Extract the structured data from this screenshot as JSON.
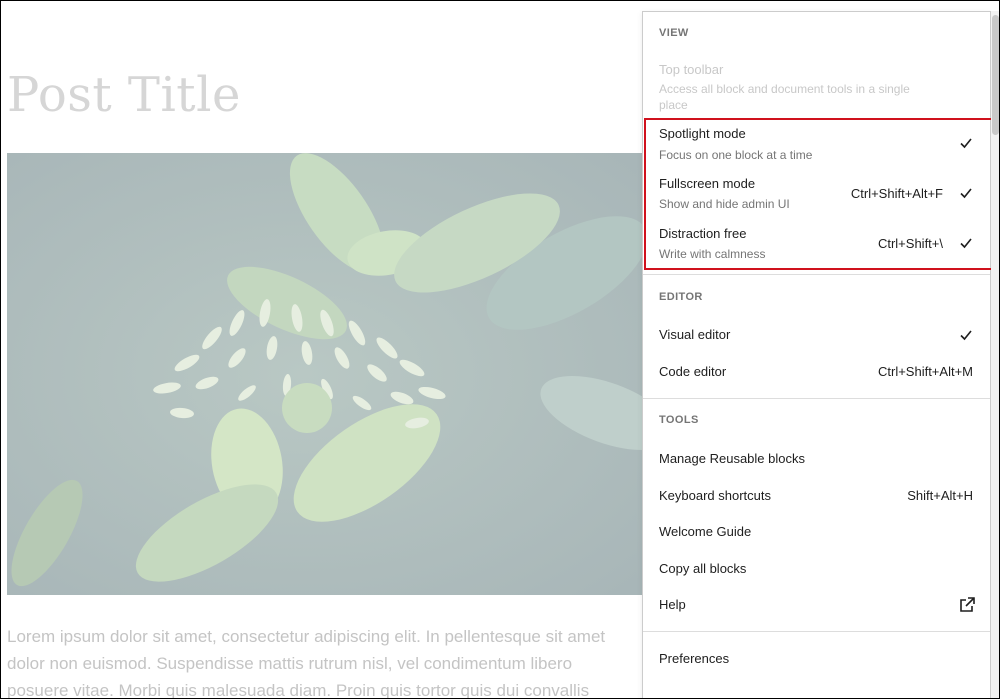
{
  "post": {
    "title": "Post Title",
    "paragraph_lines": [
      "Lorem ipsum dolor sit amet, consectetur adipiscing elit. In pellentesque sit amet",
      "dolor non euismod. Suspendisse mattis rutrum nisl, vel condimentum libero",
      "posuere vitae. Morbi quis malesuada diam. Proin quis tortor quis dui convallis"
    ]
  },
  "menu": {
    "view": {
      "label": "VIEW",
      "items": [
        {
          "label": "Top toolbar",
          "description": "Access all block and document tools in a single",
          "description2": "place",
          "shortcut": "",
          "checked": false,
          "disabled": true
        },
        {
          "label": "Spotlight mode",
          "description": "Focus on one block at a time",
          "shortcut": "",
          "checked": true
        },
        {
          "label": "Fullscreen mode",
          "description": "Show and hide admin UI",
          "shortcut": "Ctrl+Shift+Alt+F",
          "checked": true
        },
        {
          "label": "Distraction free",
          "description": "Write with calmness",
          "shortcut": "Ctrl+Shift+\\",
          "checked": true
        }
      ]
    },
    "editor": {
      "label": "EDITOR",
      "items": [
        {
          "label": "Visual editor",
          "shortcut": "",
          "checked": true
        },
        {
          "label": "Code editor",
          "shortcut": "Ctrl+Shift+Alt+M",
          "checked": false
        }
      ]
    },
    "tools": {
      "label": "TOOLS",
      "items": [
        {
          "label": "Manage Reusable blocks",
          "shortcut": ""
        },
        {
          "label": "Keyboard shortcuts",
          "shortcut": "Shift+Alt+H"
        },
        {
          "label": "Welcome Guide",
          "shortcut": ""
        },
        {
          "label": "Copy all blocks",
          "shortcut": ""
        },
        {
          "label": "Help",
          "shortcut": "",
          "icon": "external-link-icon"
        }
      ]
    },
    "preferences": {
      "label": "Preferences"
    }
  },
  "icons": {
    "check": "check-icon",
    "external": "external-link-icon"
  },
  "colors": {
    "highlight": "#d0111d",
    "muted": "#757575",
    "text": "#1e1e1e"
  }
}
